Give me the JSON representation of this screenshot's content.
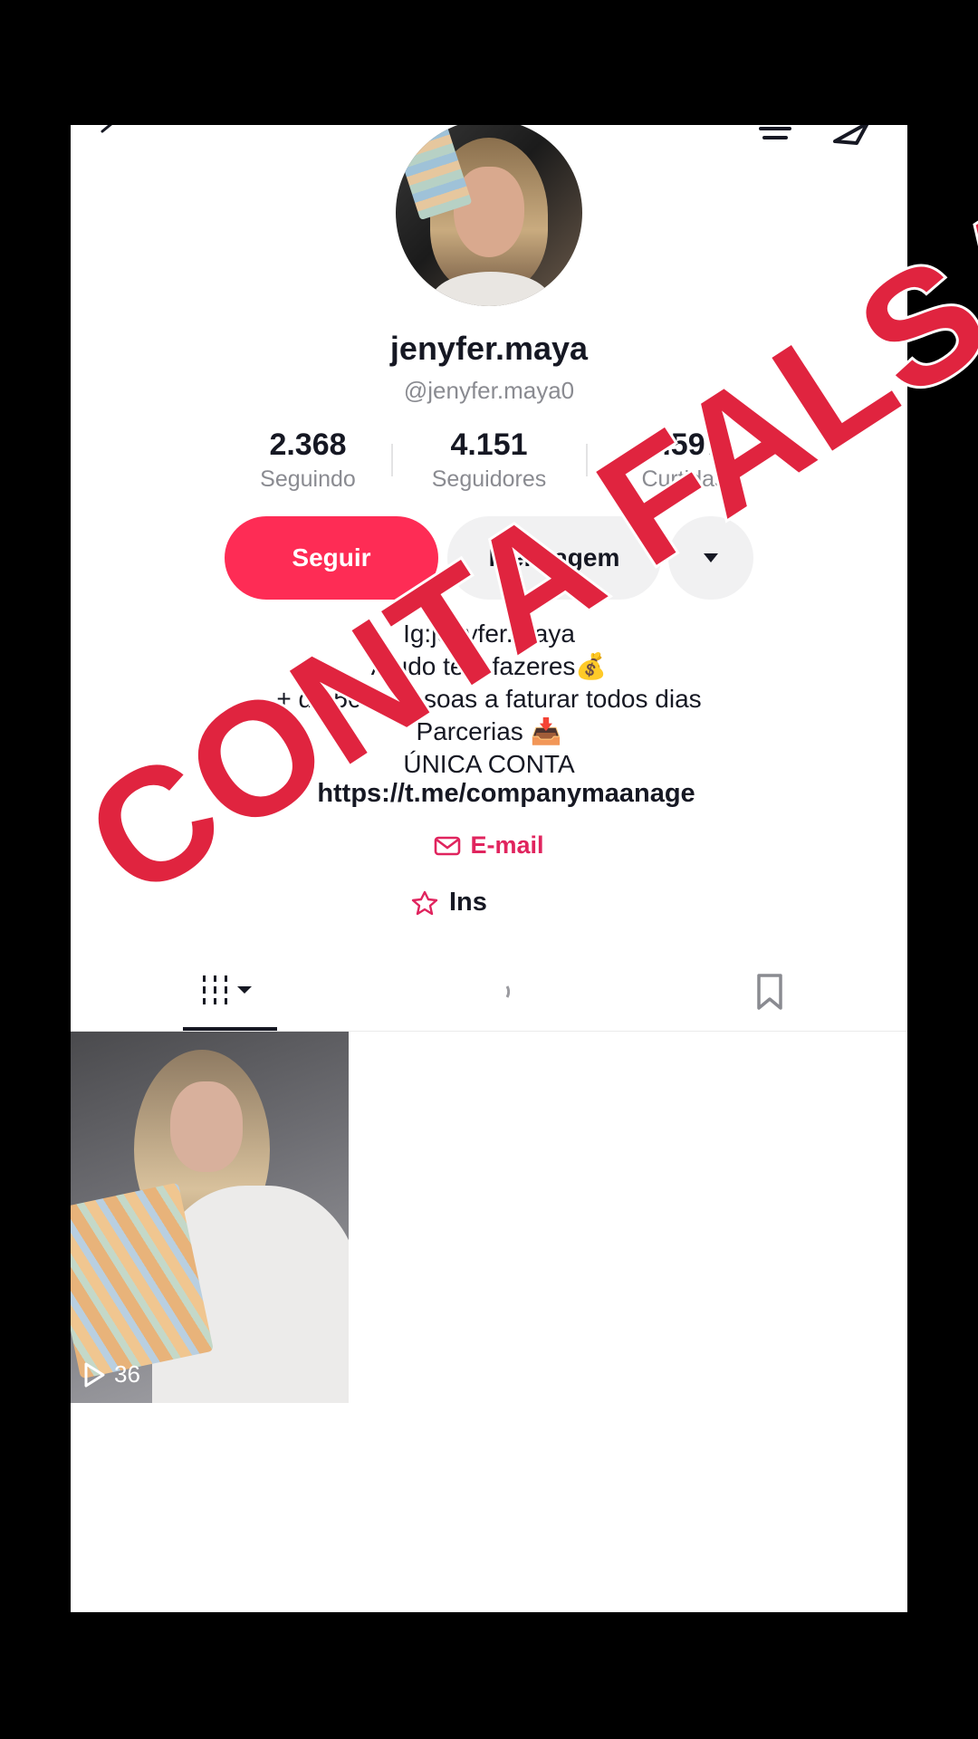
{
  "profile": {
    "display_name": "jenyfer.maya",
    "handle": "@jenyfer.maya0"
  },
  "stats": [
    {
      "value": "2.368",
      "label": "Seguindo"
    },
    {
      "value": "4.151",
      "label": "Seguidores"
    },
    {
      "value": "3.597",
      "label": "Curtidas"
    }
  ],
  "actions": {
    "follow_label": "Seguir",
    "message_label": "Mensagem"
  },
  "bio": {
    "lines": [
      "Ig:jenyfer.maya",
      "Ajudo te a fazeres💰",
      "+ de 500 pessoas a faturar todos dias",
      "Parcerias 📥",
      "ÚNICA CONTA"
    ],
    "link": "https://t.me/companymaanage",
    "email_label": "E-mail",
    "instagram_label": "Ins"
  },
  "videos": [
    {
      "views": "36"
    }
  ],
  "watermark": "CONTA FALSA",
  "colors": {
    "accent": "#fe2c55",
    "email": "#e0245e",
    "watermark": "#e0243f"
  }
}
